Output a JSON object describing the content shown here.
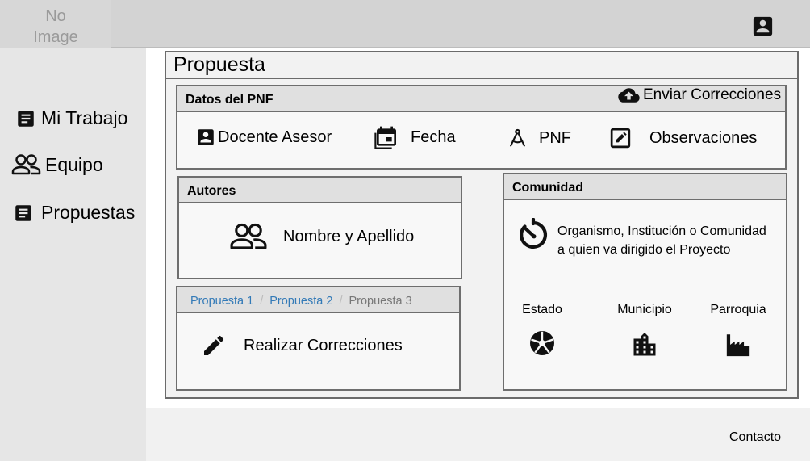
{
  "header": {
    "logo_line1": "No",
    "logo_line2": "Image",
    "avatar_icon": "account-box-icon"
  },
  "sidebar": {
    "items": [
      {
        "label": "Mi Trabajo",
        "icon": "document-icon"
      },
      {
        "label": "Equipo",
        "icon": "people-icon"
      },
      {
        "label": "Propuestas",
        "icon": "document-icon"
      }
    ]
  },
  "main": {
    "title": "Propuesta",
    "datos": {
      "title": "Datos del PNF",
      "action_label": "Enviar Correcciones",
      "action_icon": "cloud-upload-icon",
      "items": [
        {
          "label": "Docente Asesor",
          "icon": "account-box-icon"
        },
        {
          "label": "Fecha",
          "icon": "calendar-icon"
        },
        {
          "label": "PNF",
          "icon": "compass-icon"
        },
        {
          "label": "Observaciones",
          "icon": "edit-box-icon"
        }
      ]
    },
    "autores": {
      "title": "Autores",
      "item_label": "Nombre y Apellido",
      "item_icon": "people-icon"
    },
    "correcciones": {
      "breadcrumb": [
        "Propuesta 1",
        "Propuesta 2",
        "Propuesta 3"
      ],
      "action_label": "Realizar Correcciones",
      "action_icon": "pencil-icon"
    },
    "comunidad": {
      "title": "Comunidad",
      "description_line1": "Organismo, Institución o Comunidad",
      "description_line2": "a quien va dirigido el Proyecto",
      "description_icon": "timer-icon",
      "locations": [
        {
          "label": "Estado",
          "icon": "aperture-icon"
        },
        {
          "label": "Municipio",
          "icon": "city-icon"
        },
        {
          "label": "Parroquia",
          "icon": "factory-icon"
        }
      ]
    }
  },
  "footer": {
    "contact": "Contacto"
  },
  "colors": {
    "topbar": "#d3d3d3",
    "sidebar": "#e6e6e6",
    "panel_header": "#e0e0e0",
    "link": "#337ab7"
  }
}
